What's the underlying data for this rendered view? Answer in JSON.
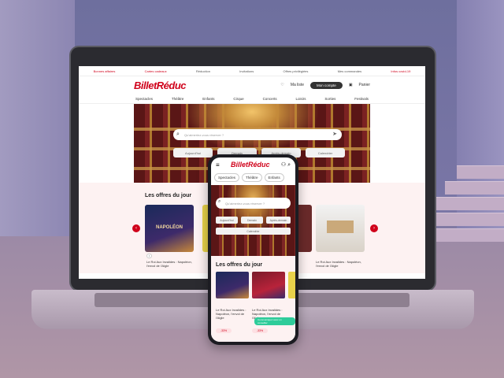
{
  "desktop": {
    "topbar": [
      "Bonnes affaires",
      "Cartes cadeaux",
      "Réduction",
      "Invitations",
      "Offres privilégiées",
      "Mes commandes",
      "Infos covid-19"
    ],
    "logo": "BilletRéduc",
    "header": {
      "wishlist": "Ma liste",
      "account": "Mon compte",
      "cart": "Panier"
    },
    "nav": [
      "Spectacles",
      "Théâtre",
      "Enfants",
      "Cirque",
      "Concerts",
      "Loisirs",
      "Sorties",
      "Festivals"
    ],
    "search": {
      "placeholder": "Qu'aimeriez-vous réserver ?"
    },
    "filters": [
      "Aujourd'hui",
      "Demain",
      "Après-demain",
      "Calendrier"
    ],
    "offers_title": "Les offres du jour",
    "cards": [
      {
        "title": "Napoléon",
        "text": "Le Roi Aux Invalides : Napoléon, l'envol de l'Aigle"
      },
      {
        "title": "",
        "text": "Le Roi Aux Invalides : Napoléon, l'envol de l'Aigle"
      }
    ],
    "card_image_title": "NAPOLÉON"
  },
  "phone": {
    "logo": "BilletRéduc",
    "tabs": [
      "Spectacles",
      "Théâtre",
      "Enfants"
    ],
    "search": {
      "placeholder": "Qu'aimeriez-vous réserver ?"
    },
    "filters": [
      "Aujourd'hui",
      "Demain",
      "Après-demain",
      "Calendrier"
    ],
    "offers_title": "Les offres du jour",
    "card_text": "Le Roi Aux Invalides : Napoléon, l'envol de l'Aigle",
    "discount": "-33%",
    "toast": "Communiquez avec un conseiller"
  },
  "colors": {
    "brand": "#d0021b",
    "accent_green": "#2ecc9a"
  }
}
